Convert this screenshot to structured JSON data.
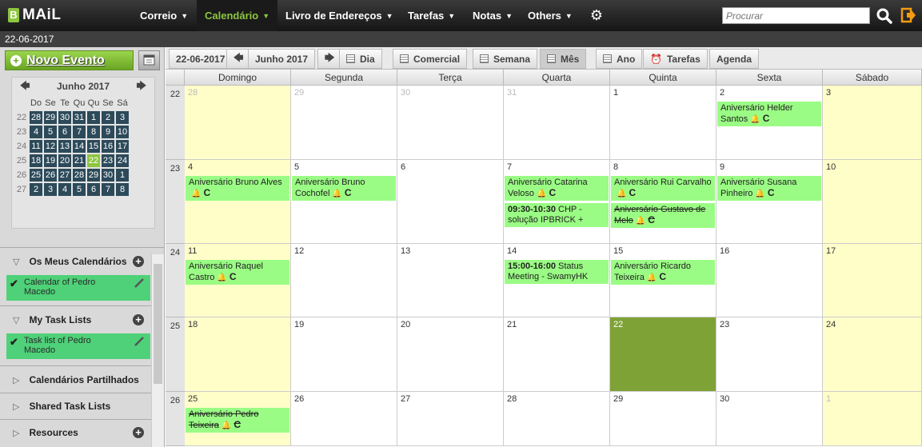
{
  "app": {
    "logo_letter": "B",
    "logo_text": "MAiL"
  },
  "nav": [
    {
      "label": "Correio"
    },
    {
      "label": "Calendário"
    },
    {
      "label": "Livro de Endereços"
    },
    {
      "label": "Tarefas"
    },
    {
      "label": "Notas"
    },
    {
      "label": "Others"
    }
  ],
  "search": {
    "placeholder": "Procurar"
  },
  "current_date": "22-06-2017",
  "sidebar": {
    "new_event_label": "Novo Evento",
    "mini_calendar": {
      "month": "Junho 2017",
      "weekdays": [
        "Do",
        "Se",
        "Te",
        "Qu",
        "Qu",
        "Se",
        "Sá"
      ],
      "weeks": [
        {
          "wk": "22",
          "days": [
            "28",
            "29",
            "30",
            "31",
            "1",
            "2",
            "3"
          ]
        },
        {
          "wk": "23",
          "days": [
            "4",
            "5",
            "6",
            "7",
            "8",
            "9",
            "10"
          ]
        },
        {
          "wk": "24",
          "days": [
            "11",
            "12",
            "13",
            "14",
            "15",
            "16",
            "17"
          ]
        },
        {
          "wk": "25",
          "days": [
            "18",
            "19",
            "20",
            "21",
            "22",
            "23",
            "24"
          ]
        },
        {
          "wk": "26",
          "days": [
            "25",
            "26",
            "27",
            "28",
            "29",
            "30",
            "1"
          ]
        },
        {
          "wk": "27",
          "days": [
            "2",
            "3",
            "4",
            "5",
            "6",
            "7",
            "8"
          ]
        }
      ],
      "today": "22"
    },
    "sections": {
      "my_calendars": "Os Meus Calendários",
      "my_calendar_item": "Calendar of Pedro Macedo",
      "my_task_lists": "My Task Lists",
      "my_task_item": "Task list of Pedro Macedo",
      "shared_calendars": "Calendários Partilhados",
      "shared_tasks": "Shared Task Lists",
      "resources": "Resources"
    }
  },
  "toolbar": {
    "date": "22-06-2017",
    "month": "Junho 2017",
    "views": [
      "Dia",
      "Comercial",
      "Semana",
      "Mês",
      "Ano",
      "Tarefas",
      "Agenda"
    ]
  },
  "calendar": {
    "weekdays": [
      "Domingo",
      "Segunda",
      "Terça",
      "Quarta",
      "Quinta",
      "Sexta",
      "Sábado"
    ],
    "weeks": [
      {
        "wk": "22",
        "days": [
          {
            "d": "28",
            "other": true,
            "events": []
          },
          {
            "d": "29",
            "other": true,
            "events": []
          },
          {
            "d": "30",
            "other": true,
            "events": []
          },
          {
            "d": "31",
            "other": true,
            "events": []
          },
          {
            "d": "1",
            "events": []
          },
          {
            "d": "2",
            "events": [
              {
                "text": "Aniversário Helder Santos",
                "icons": true
              }
            ]
          },
          {
            "d": "3",
            "events": []
          }
        ]
      },
      {
        "wk": "23",
        "days": [
          {
            "d": "4",
            "events": [
              {
                "text": "Aniversário Bruno Alves",
                "icons": true
              }
            ]
          },
          {
            "d": "5",
            "events": [
              {
                "text": "Aniversário Bruno Cochofel",
                "icons": true
              }
            ]
          },
          {
            "d": "6",
            "events": []
          },
          {
            "d": "7",
            "events": [
              {
                "text": "Aniversário Catarina Veloso",
                "icons": true
              },
              {
                "time": "09:30-10:30",
                "text": "CHP - solução IPBRICK +"
              }
            ]
          },
          {
            "d": "8",
            "events": [
              {
                "text": "Aniversário Rui Carvalho",
                "icons": true
              },
              {
                "text": "Aniversário Gustavo de Melo",
                "icons": true,
                "strike": true
              }
            ]
          },
          {
            "d": "9",
            "events": [
              {
                "text": "Aniversário Susana Pinheiro",
                "icons": true
              }
            ]
          },
          {
            "d": "10",
            "events": []
          }
        ]
      },
      {
        "wk": "24",
        "days": [
          {
            "d": "11",
            "events": [
              {
                "text": "Aniversário Raquel Castro",
                "icons": true
              }
            ]
          },
          {
            "d": "12",
            "events": []
          },
          {
            "d": "13",
            "events": []
          },
          {
            "d": "14",
            "events": [
              {
                "time": "15:00-16:00",
                "text": "Status Meeting - SwamyHK"
              }
            ]
          },
          {
            "d": "15",
            "events": [
              {
                "text": "Aniversário Ricardo Teixeira",
                "icons": true
              }
            ]
          },
          {
            "d": "16",
            "events": []
          },
          {
            "d": "17",
            "events": []
          }
        ]
      },
      {
        "wk": "25",
        "days": [
          {
            "d": "18",
            "events": []
          },
          {
            "d": "19",
            "events": []
          },
          {
            "d": "20",
            "events": []
          },
          {
            "d": "21",
            "events": []
          },
          {
            "d": "22",
            "today": true,
            "events": []
          },
          {
            "d": "23",
            "events": []
          },
          {
            "d": "24",
            "events": []
          }
        ]
      },
      {
        "wk": "26",
        "days": [
          {
            "d": "25",
            "events": [
              {
                "text": "Aniversário Pedro Teixeira",
                "icons": true,
                "strike": true
              }
            ]
          },
          {
            "d": "26",
            "events": []
          },
          {
            "d": "27",
            "events": []
          },
          {
            "d": "28",
            "events": []
          },
          {
            "d": "29",
            "events": []
          },
          {
            "d": "30",
            "events": []
          },
          {
            "d": "1",
            "other": true,
            "events": []
          }
        ]
      }
    ]
  }
}
